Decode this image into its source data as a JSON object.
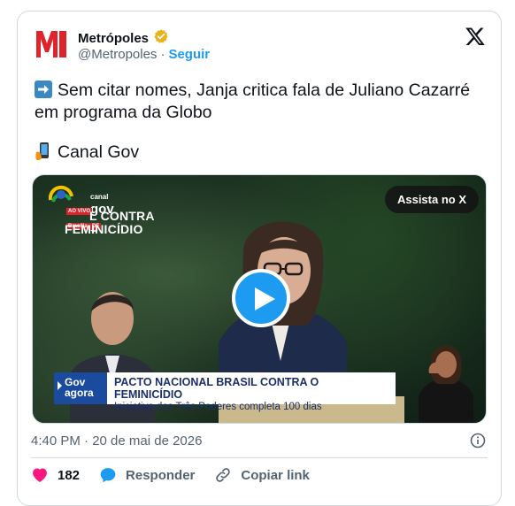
{
  "account": {
    "name": "Metrópoles",
    "handle": "@Metropoles",
    "separator": "·",
    "follow_label": "Seguir"
  },
  "post": {
    "line1": "Sem citar nomes, Janja critica fala de Juliano Cazarré",
    "line2": "em programa da Globo",
    "line3": "Canal Gov"
  },
  "media": {
    "watch_label": "Assista no X",
    "channel_name": "canal",
    "channel_name2": "gov",
    "live_tag": "AO VIVO",
    "location_tag": "Brasília - DF",
    "backdrop_line1": "L CONTRA O",
    "backdrop_line2": "FEMINICÍDIO",
    "lower_third_brand_1": "Gov",
    "lower_third_brand_2": "agora",
    "lower_third_title": "PACTO NACIONAL BRASIL CONTRA O FEMINICÍDIO",
    "lower_third_subtitle": "Iniciativa dos Três Poderes completa 100 dias"
  },
  "footer": {
    "timestamp": "4:40 PM · 20 de mai de 2026",
    "likes": "182",
    "reply_label": "Responder",
    "copy_link_label": "Copiar link"
  },
  "colors": {
    "brand_red": "#e0222a",
    "link_blue": "#1d9bf0",
    "like_pink": "#f91880",
    "muted": "#536471"
  }
}
